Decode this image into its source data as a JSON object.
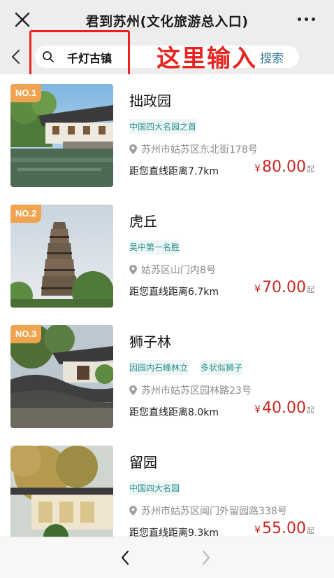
{
  "titlebar": {
    "title": "君到苏州(文化旅游总入口)",
    "close_icon": "close-icon",
    "more_icon": "more-icon"
  },
  "search": {
    "value": "千灯古镇",
    "button_label": "搜索",
    "annotation": "这里输入",
    "annotation_color": "#e8241f"
  },
  "accent_colors": {
    "price": "#c9261e",
    "tag": "#2a8f8a",
    "rank_badge": "#f0a450"
  },
  "attractions": [
    {
      "rank": "NO.1",
      "name": "拙政园",
      "tags": [
        "中国四大名园之首"
      ],
      "address": "苏州市姑苏区东北街178号",
      "distance": "距您直线距离7.7km",
      "currency": "¥",
      "price": "80.00",
      "price_suffix": "起"
    },
    {
      "rank": "NO.2",
      "name": "虎丘",
      "tags": [
        "吴中第一名胜"
      ],
      "address": "姑苏区山门内8号",
      "distance": "距您直线距离6.7km",
      "currency": "¥",
      "price": "70.00",
      "price_suffix": "起"
    },
    {
      "rank": "NO.3",
      "name": "狮子林",
      "tags": [
        "因园内石峰林立",
        "多状似狮子"
      ],
      "address": "苏州市姑苏区园林路23号",
      "distance": "距您直线距离8.0km",
      "currency": "¥",
      "price": "40.00",
      "price_suffix": "起"
    },
    {
      "rank": "",
      "name": "留园",
      "tags": [
        "中国四大名园"
      ],
      "address": "苏州市姑苏区阊门外留园路338号",
      "distance": "距您直线距离9.3km",
      "currency": "¥",
      "price": "55.00",
      "price_suffix": "起"
    }
  ]
}
